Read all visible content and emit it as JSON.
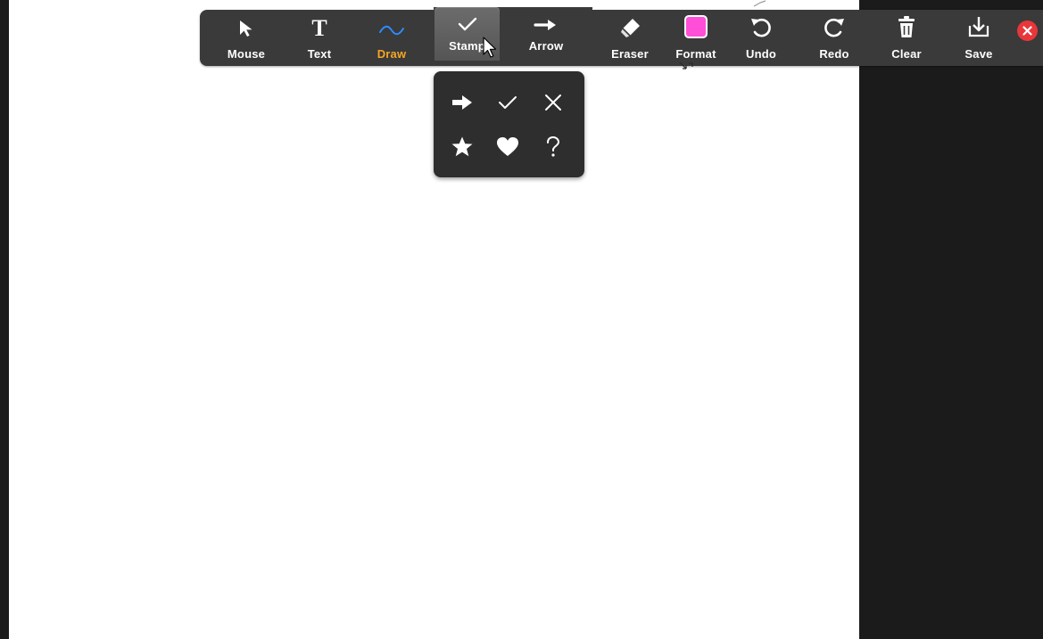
{
  "toolbar": {
    "tools": [
      {
        "id": "mouse",
        "label": "Mouse",
        "icon": "pointer-arrow-icon"
      },
      {
        "id": "text",
        "label": "Text",
        "icon": "text-T-icon"
      },
      {
        "id": "draw",
        "label": "Draw",
        "icon": "squiggle-line-icon"
      },
      {
        "id": "stamp",
        "label": "Stamp",
        "icon": "checkmark-icon"
      },
      {
        "id": "arrow",
        "label": "Arrow",
        "icon": "right-arrow-icon"
      },
      {
        "id": "eraser",
        "label": "Eraser",
        "icon": "eraser-icon"
      },
      {
        "id": "format",
        "label": "Format",
        "icon": "color-swatch-icon"
      },
      {
        "id": "undo",
        "label": "Undo",
        "icon": "undo-icon"
      },
      {
        "id": "redo",
        "label": "Redo",
        "icon": "redo-icon"
      },
      {
        "id": "clear",
        "label": "Clear",
        "icon": "trash-icon"
      },
      {
        "id": "save",
        "label": "Save",
        "icon": "download-icon"
      }
    ],
    "selected_tool": "draw",
    "open_menu": "stamp",
    "close_icon": "close-x-icon"
  },
  "stamp_menu": {
    "options": [
      "arrow-stamp-icon",
      "check-stamp-icon",
      "x-stamp-icon",
      "star-stamp-icon",
      "heart-stamp-icon",
      "question-stamp-icon"
    ]
  },
  "colors": {
    "toolbar_bg": "#3a3a3a",
    "active_draw_label": "#f5a623",
    "draw_icon_stroke": "#2d8cff",
    "format_swatch": "#ff4fd8",
    "close_button": "#e8363a",
    "canvas": "#ffffff",
    "side_panel": "#1b1b1b"
  }
}
